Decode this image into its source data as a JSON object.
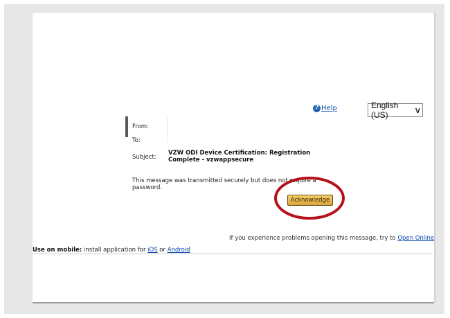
{
  "toolbar": {
    "help_label": "Help",
    "help_icon": "help-icon",
    "language": "English (US)"
  },
  "header": {
    "from_label": "From:",
    "to_label": "To:",
    "subject_label": "Subject:",
    "subject_value": "VZW ODI Device Certification: Registration Complete - vzwappsecure"
  },
  "body": {
    "message": "This message was transmitted securely but does not require a password.",
    "acknowledge_label": "Acknowledge"
  },
  "footer": {
    "trouble_text": "If you experience problems opening this message, try to",
    "open_online_label": "Open Online",
    "mobile_prefix": "Use on mobile:",
    "mobile_text": "install application for",
    "ios_label": "iOS",
    "or_text": "or",
    "android_label": "Android"
  },
  "colors": {
    "button_accent": "#dba63b",
    "highlight_ring": "#b5121b",
    "link": "#0645ad"
  }
}
